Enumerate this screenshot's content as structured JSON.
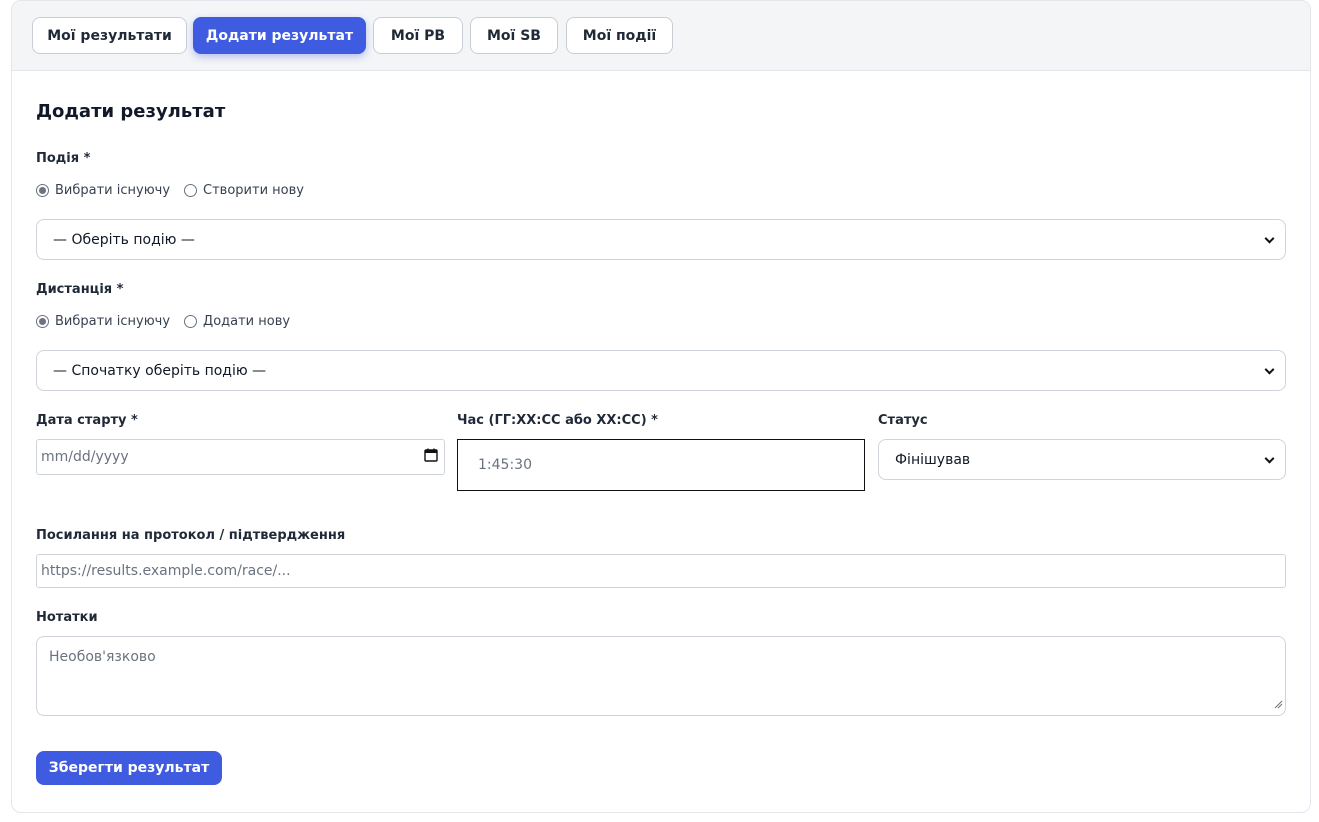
{
  "tabs": [
    {
      "label": "Мої результати"
    },
    {
      "label": "Додати результат"
    },
    {
      "label": "Мої PB"
    },
    {
      "label": "Мої SB"
    },
    {
      "label": "Мої події"
    }
  ],
  "form": {
    "title": "Додати результат",
    "event": {
      "label": "Подія *",
      "option_existing": "Вибрати існуючу",
      "option_new": "Створити нову",
      "select_value": "— Оберіть подію —"
    },
    "distance": {
      "label": "Дистанція *",
      "option_existing": "Вибрати існуючу",
      "option_new": "Додати нову",
      "select_value": "— Спочатку оберіть подію —"
    },
    "start_date": {
      "label": "Дата старту *",
      "placeholder": "mm/dd/yyyy"
    },
    "time": {
      "label": "Час (ГГ:ХХ:СС або ХХ:СС) *",
      "placeholder": "1:45:30"
    },
    "status": {
      "label": "Статус",
      "value": "Фінішував"
    },
    "link": {
      "label": "Посилання на протокол / підтвердження",
      "placeholder": "https://results.example.com/race/..."
    },
    "notes": {
      "label": "Нотатки",
      "placeholder": "Необов'язково"
    },
    "submit_label": "Зберегти результат"
  },
  "colors": {
    "accent": "#3f5be0",
    "border": "#cfd4dc"
  }
}
